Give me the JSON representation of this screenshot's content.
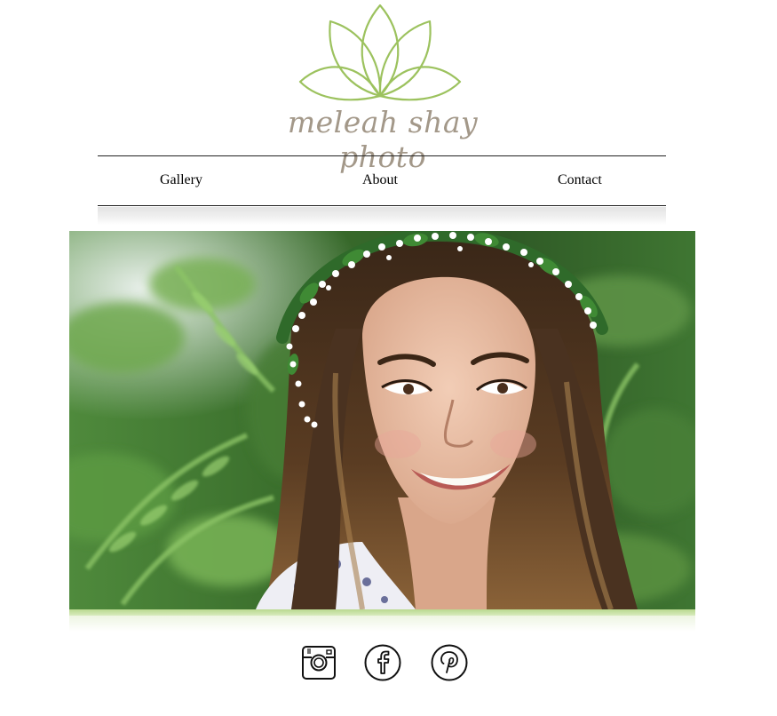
{
  "brand": {
    "logo_text": "meleah shay photo",
    "logo_color": "#9cc25e",
    "text_color": "#a39889"
  },
  "nav": {
    "items": [
      {
        "label": "Gallery"
      },
      {
        "label": "About"
      },
      {
        "label": "Contact"
      }
    ]
  },
  "hero": {
    "accent_color": "#b9d98f"
  },
  "social": [
    {
      "icon": "instagram-icon"
    },
    {
      "icon": "facebook-icon"
    },
    {
      "icon": "pinterest-icon"
    }
  ]
}
